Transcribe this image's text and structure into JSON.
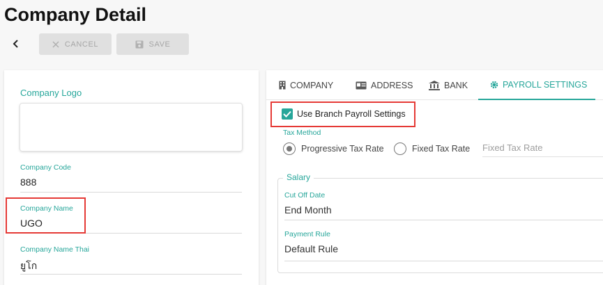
{
  "page": {
    "title": "Company Detail"
  },
  "toolbar": {
    "cancel_label": "CANCEL",
    "save_label": "SAVE"
  },
  "left": {
    "logo_label": "Company Logo",
    "fields": [
      {
        "label": "Company Code",
        "value": "888"
      },
      {
        "label": "Company Name",
        "value": "UGO"
      },
      {
        "label": "Company Name Thai",
        "value": "ยูโก"
      }
    ]
  },
  "tabs": [
    {
      "label": "COMPANY",
      "icon": "building-icon"
    },
    {
      "label": "ADDRESS",
      "icon": "id-card-icon"
    },
    {
      "label": "BANK",
      "icon": "bank-icon"
    },
    {
      "label": "PAYROLL SETTINGS",
      "icon": "gear-icon",
      "active": true
    }
  ],
  "payroll": {
    "use_branch_label": "Use Branch Payroll Settings",
    "use_branch_checked": true,
    "tax_method_label": "Tax Method",
    "tax_options": [
      "Progressive Tax Rate",
      "Fixed Tax Rate"
    ],
    "tax_selected": "Progressive Tax Rate",
    "fixed_rate_placeholder": "Fixed Tax Rate",
    "salary_legend": "Salary",
    "cut_off_label": "Cut Off Date",
    "cut_off_value": "End Month",
    "payment_rule_label": "Payment Rule",
    "payment_rule_value": "Default Rule"
  },
  "colors": {
    "accent": "#26a69a",
    "highlight": "#e53935",
    "disabled_btn": "#e0e0e0"
  }
}
